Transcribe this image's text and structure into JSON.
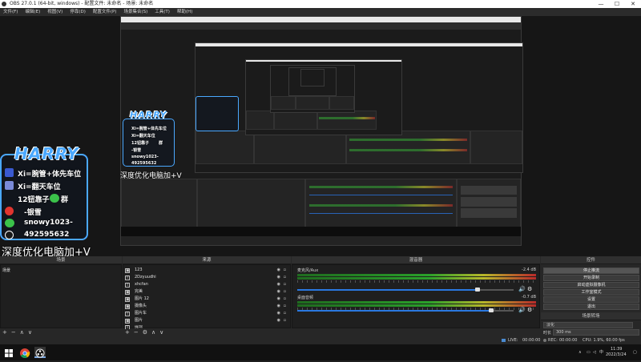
{
  "window": {
    "title": "OBS 27.0.1 (64-bit, windows) - 配置文件: 未命名 - 场景: 未命名",
    "min_glyph": "—",
    "max_glyph": "☐",
    "close_glyph": "✕"
  },
  "menu": [
    "文件(F)",
    "编辑(E)",
    "视图(V)",
    "停靠(D)",
    "配置文件(P)",
    "场景集合(S)",
    "工具(T)",
    "帮助(H)"
  ],
  "overlay": {
    "logo": "HARRY",
    "lines": [
      "Xi=腕管+体先车位",
      "Xi=翻天车位",
      "12钮靠子",
      "群",
      "-银雪",
      "snowy1023-",
      "492595632"
    ],
    "caption": "深度优化电脑加+V",
    "nested_logo": "HARRY",
    "nested_lines": [
      "Xi=腕管+体先车位",
      "Xi=翻天车位",
      "12钮靠子",
      "群",
      "-银雪",
      "snowy1023-",
      "492595632"
    ],
    "nested_caption": "深度优化电脑加+V"
  },
  "docks": {
    "scenes": {
      "title": "场景",
      "items": [
        "场景"
      ],
      "footer": [
        "+",
        "−",
        "∧",
        "∨"
      ]
    },
    "sources": {
      "title": "来源",
      "items": [
        {
          "icon": "image-icon",
          "glyph": "▣",
          "label": "123"
        },
        {
          "icon": "text-icon",
          "glyph": "T",
          "label": "2Dzyuudhi"
        },
        {
          "icon": "text-icon",
          "glyph": "T",
          "label": "xhcfan"
        },
        {
          "icon": "image-icon",
          "glyph": "▣",
          "label": "完美"
        },
        {
          "icon": "image-icon",
          "glyph": "▣",
          "label": "图片 12"
        },
        {
          "icon": "image-icon",
          "glyph": "▣",
          "label": "摄像头"
        },
        {
          "icon": "text-icon",
          "glyph": "T",
          "label": "图片车"
        },
        {
          "icon": "image-icon",
          "glyph": "▣",
          "label": "图片"
        },
        {
          "icon": "text-icon",
          "glyph": "T",
          "label": "提现"
        }
      ],
      "footer": [
        "+",
        "−",
        "⚙",
        "∧",
        "∨"
      ]
    },
    "mixer": {
      "title": "混音器",
      "channels": [
        {
          "name": "麦克风/Aux",
          "db": "-2.4 dB",
          "level": 0.92
        },
        {
          "name": "桌面音频",
          "db": "-0.7 dB",
          "level": 0.98
        }
      ],
      "ticks_label": "",
      "speaker_glyph": "🔊",
      "gear_glyph": "⚙"
    },
    "transitions": {
      "title": "场景转场",
      "mode": "淡化",
      "duration_label": "时长",
      "duration": "300 ms"
    },
    "controls": {
      "title": "控件",
      "buttons": [
        "停止推流",
        "开始录制",
        "启动虚拟摄像机",
        "工作室模式",
        "设置",
        "退出"
      ]
    }
  },
  "status": {
    "live_label": "LIVE:",
    "live_time": "00:00:00",
    "rec_label": "REC:",
    "rec_time": "00:00:00",
    "cpu": "CPU: 1.9%, 60.00 fps"
  },
  "taskbar": {
    "time": "11:39",
    "date": "2022/3/24",
    "ime": "中",
    "tray_up": "∧"
  },
  "colors": {
    "accent": "#4aa8ff",
    "slider": "#2a78e0"
  }
}
